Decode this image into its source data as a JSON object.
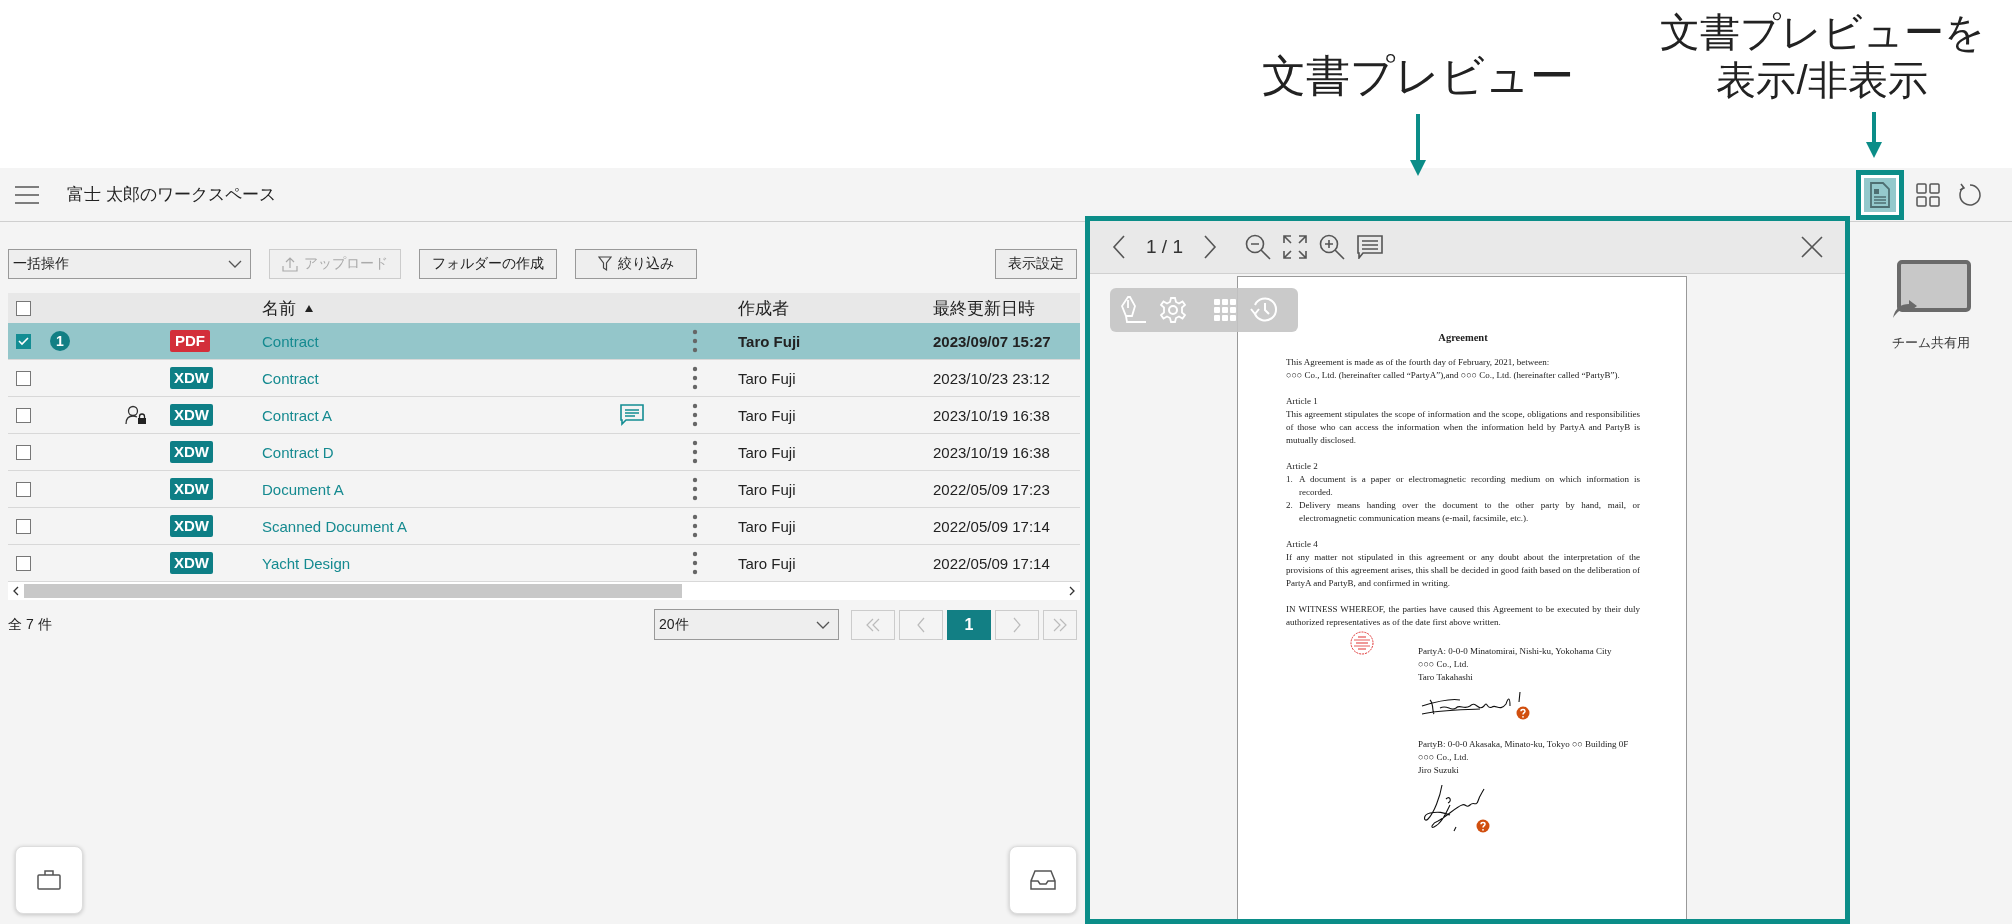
{
  "annotations": {
    "preview": {
      "lines": [
        "文書プレビュー"
      ]
    },
    "toggle": {
      "lines": [
        "文書プレビューを",
        "表示/非表示"
      ]
    }
  },
  "header": {
    "title": "富士 太郎のワークスペース",
    "preview_toggle": {
      "on": true
    }
  },
  "toolbar": {
    "bulk_action": "一括操作",
    "upload": {
      "label": "アップロード",
      "disabled": true
    },
    "create_folder": "フォルダーの作成",
    "filter": "絞り込み",
    "display_settings": "表示設定"
  },
  "table": {
    "all_checked": false,
    "columns": [
      {
        "label": "名前",
        "sorted": true
      },
      {
        "label": "作成者",
        "sorted": false
      },
      {
        "label": "最終更新日時",
        "sorted": false
      }
    ],
    "rows": [
      {
        "checked": true,
        "selected": true,
        "badge": "1",
        "locked": false,
        "kind": "pdf",
        "file_type": "PDF",
        "name": "Contract",
        "has_comment": false,
        "author": "Taro Fuji",
        "updated": "2023/09/07 15:27"
      },
      {
        "checked": false,
        "selected": false,
        "locked": false,
        "kind": "xdw",
        "file_type": "XDW",
        "name": "Contract",
        "has_comment": false,
        "author": "Taro Fuji",
        "updated": "2023/10/23 23:12"
      },
      {
        "checked": false,
        "selected": false,
        "locked": true,
        "kind": "xdw",
        "file_type": "XDW",
        "name": "Contract A",
        "has_comment": true,
        "author": "Taro Fuji",
        "updated": "2023/10/19 16:38"
      },
      {
        "checked": false,
        "selected": false,
        "locked": false,
        "kind": "xdw",
        "file_type": "XDW",
        "name": "Contract D",
        "has_comment": false,
        "author": "Taro Fuji",
        "updated": "2023/10/19 16:38"
      },
      {
        "checked": false,
        "selected": false,
        "locked": false,
        "kind": "xdw",
        "file_type": "XDW",
        "name": "Document A",
        "has_comment": false,
        "author": "Taro Fuji",
        "updated": "2022/05/09 17:23"
      },
      {
        "checked": false,
        "selected": false,
        "locked": false,
        "kind": "xdw",
        "file_type": "XDW",
        "name": "Scanned Document A",
        "has_comment": false,
        "author": "Taro Fuji",
        "updated": "2022/05/09 17:14"
      },
      {
        "checked": false,
        "selected": false,
        "locked": false,
        "kind": "xdw",
        "file_type": "XDW",
        "name": "Yacht Design",
        "has_comment": false,
        "author": "Taro Fuji",
        "updated": "2022/05/09 17:14"
      }
    ]
  },
  "footer": {
    "total": "全 7 件",
    "page_size": "20件",
    "pages": [
      {
        "label": "1",
        "selected": true
      }
    ]
  },
  "preview": {
    "page": "1 / 1",
    "document": [
      {
        "kind": "title",
        "text": "Agreement"
      },
      {
        "kind": "lines",
        "lines": [
          "This Agreement is made as of the fourth day of February, 2021, between:",
          "○○○ Co., Ltd. (hereinafter called “PartyA”),and  ○○○ Co., Ltd. (hereinafter called “PartyB”)."
        ]
      },
      {
        "kind": "heading",
        "text": "Article 1"
      },
      {
        "kind": "para",
        "text": "This agreement stipulates the scope of information and the scope, obligations and responsibilities of those who can access the information when the information held by PartyA and PartyB is mutually disclosed."
      },
      {
        "kind": "heading",
        "text": "Article 2"
      },
      {
        "kind": "list",
        "items": [
          {
            "number": "1.",
            "text": "A document is a paper or electromagnetic recording medium on which information is recorded."
          },
          {
            "number": "2.",
            "text": "Delivery means handing over the document to the other party by hand, mail, or electromagnetic communication means (e-mail, facsimile, etc.)."
          }
        ]
      },
      {
        "kind": "heading",
        "text": "Article 4"
      },
      {
        "kind": "para",
        "text": "If any matter not stipulated in this agreement or any doubt about the interpretation of the provisions of this agreement arises, this shall be decided in good faith based on the deliberation of PartyA and PartyB, and confirmed in writing."
      },
      {
        "kind": "para",
        "text": "IN WITNESS WHEREOF, the parties have caused this Agreement to be executed by their duly authorized representatives as of the date first above written."
      },
      {
        "kind": "party",
        "stamp": true,
        "lines": [
          "PartyA: 0-0-0 Minatomirai, Nishi-ku, Yokohama City",
          "○○○ Co., Ltd.",
          "Taro Takahashi"
        ]
      },
      {
        "kind": "party",
        "stamp": false,
        "lines": [
          "PartyB: 0-0-0 Akasaka, Minato-ku, Tokyo ○○ Building 0F",
          "○○○ Co., Ltd.",
          "Jiro Suzuki"
        ]
      }
    ]
  },
  "side_panel": {
    "items": [
      {
        "label": "チーム共有用"
      }
    ]
  }
}
